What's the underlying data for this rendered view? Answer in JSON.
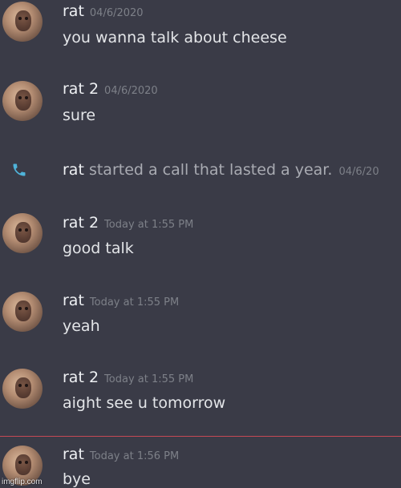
{
  "messages": [
    {
      "name": "rat",
      "timestamp": "04/6/2020",
      "text": "you wanna talk about cheese"
    },
    {
      "name": "rat 2",
      "timestamp": "04/6/2020",
      "text": "sure"
    },
    {
      "name": "rat 2",
      "timestamp": "Today at 1:55 PM",
      "text": "good talk"
    },
    {
      "name": "rat",
      "timestamp": "Today at 1:55 PM",
      "text": "yeah"
    },
    {
      "name": "rat 2",
      "timestamp": "Today at 1:55 PM",
      "text": "aight see u tomorrow"
    },
    {
      "name": "rat",
      "timestamp": "Today at 1:56 PM",
      "text": "bye"
    }
  ],
  "call": {
    "name": "rat",
    "text": "started a call that lasted a year.",
    "timestamp": "04/6/20"
  },
  "icons": {
    "avatar": "rat-avatar",
    "call": "phone-icon"
  },
  "colors": {
    "background": "#3a3b47",
    "divider": "#c44855",
    "call_icon": "#4fb3d9"
  },
  "watermark": "imgflip.com"
}
